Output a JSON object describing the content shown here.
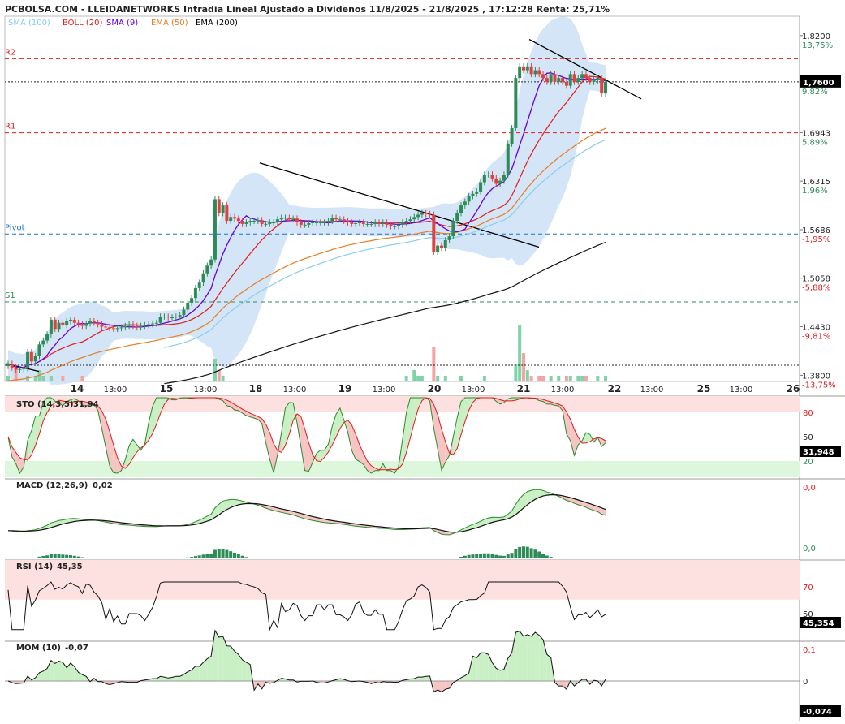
{
  "header": {
    "title": "PCBOLSA.COM - LLEIDANETWORKS Intradia Lineal Ajustado a Dividenos 11/8/2025 - 21/8/2025 , 17:12:28 Renta: 25,71%",
    "legend": [
      {
        "label": "SMA (100)",
        "color": "#87ceeb"
      },
      {
        "label": "BOLL (20)",
        "color": "#e31a1c"
      },
      {
        "label": "SMA (9)",
        "color": "#6a00d8"
      },
      {
        "label": "EMA (50)",
        "color": "#e67e22"
      },
      {
        "label": "EMA (200)",
        "color": "#000000"
      }
    ]
  },
  "price_axis": {
    "ticks": [
      {
        "price": "1,8200",
        "pct": "13,75%",
        "pct_color": "#2e8b57"
      },
      {
        "price": "1,6943",
        "pct": "5,89%",
        "pct_color": "#2e8b57"
      },
      {
        "price": "1,6315",
        "pct": "1,96%",
        "pct_color": "#2e8b57"
      },
      {
        "price": "1,5686",
        "pct": "-1,95%",
        "pct_color": "#e31a1c"
      },
      {
        "price": "1,5058",
        "pct": "-5,88%",
        "pct_color": "#e31a1c"
      },
      {
        "price": "1,4430",
        "pct": "-9,81%",
        "pct_color": "#e31a1c"
      },
      {
        "price": "1,3800",
        "pct": "-13,75%",
        "pct_color": "#e31a1c"
      }
    ],
    "current_price": "1,7600",
    "current_pct": "9,82%"
  },
  "levels": [
    {
      "label": "R2",
      "value": 1.79,
      "color": "#e31a1c"
    },
    {
      "label": "R1",
      "value": 1.694,
      "color": "#e31a1c"
    },
    {
      "label": "Pivot",
      "value": 1.563,
      "color": "#1f6fd1"
    },
    {
      "label": "S1",
      "value": 1.475,
      "color": "#2e8b57"
    }
  ],
  "time_axis": [
    "14",
    "13:00",
    "15",
    "13:00",
    "18",
    "13:00",
    "19",
    "13:00",
    "20",
    "13:00",
    "21",
    "13:00",
    "22",
    "13:00",
    "25",
    "13:00",
    "26"
  ],
  "chart_data": [
    {
      "type": "candlestick",
      "title": "",
      "yrange": [
        1.372,
        1.845
      ],
      "note_values": "approximate values read from the chart",
      "close": [
        1.395,
        1.39,
        1.387,
        1.388,
        1.389,
        1.41,
        1.398,
        1.405,
        1.42,
        1.425,
        1.433,
        1.452,
        1.44,
        1.448,
        1.445,
        1.45,
        1.452,
        1.448,
        1.446,
        1.444,
        1.447,
        1.45,
        1.448,
        1.446,
        1.443,
        1.442,
        1.441,
        1.44,
        1.441,
        1.442,
        1.444,
        1.446,
        1.444,
        1.442,
        1.444,
        1.445,
        1.446,
        1.447,
        1.448,
        1.456,
        1.456,
        1.455,
        1.455,
        1.456,
        1.458,
        1.465,
        1.474,
        1.48,
        1.493,
        1.5,
        1.512,
        1.522,
        1.53,
        1.608,
        1.59,
        1.6,
        1.58,
        1.585,
        1.583,
        1.58,
        1.576,
        1.578,
        1.58,
        1.58,
        1.581,
        1.576,
        1.576,
        1.578,
        1.578,
        1.582,
        1.584,
        1.584,
        1.583,
        1.583,
        1.578,
        1.575,
        1.575,
        1.577,
        1.578,
        1.578,
        1.578,
        1.578,
        1.58,
        1.584,
        1.582,
        1.582,
        1.58,
        1.578,
        1.576,
        1.577,
        1.578,
        1.576,
        1.576,
        1.576,
        1.578,
        1.576,
        1.578,
        1.575,
        1.573,
        1.573,
        1.575,
        1.578,
        1.58,
        1.582,
        1.585,
        1.588,
        1.59,
        1.589,
        1.588,
        1.54,
        1.548,
        1.545,
        1.555,
        1.56,
        1.58,
        1.59,
        1.6,
        1.605,
        1.612,
        1.615,
        1.618,
        1.63,
        1.64,
        1.64,
        1.635,
        1.628,
        1.632,
        1.64,
        1.68,
        1.7,
        1.765,
        1.78,
        1.775,
        1.78,
        1.77,
        1.775,
        1.77,
        1.765,
        1.76,
        1.77,
        1.76,
        1.765,
        1.76,
        1.755,
        1.77,
        1.76,
        1.765,
        1.77,
        1.765,
        1.76,
        1.762,
        1.765,
        1.745,
        1.76
      ],
      "volume": [
        1,
        0,
        2,
        0,
        0,
        1,
        0,
        1,
        2,
        1,
        0,
        1,
        0,
        0,
        1,
        0,
        0,
        0,
        0,
        1,
        0,
        0,
        0,
        0,
        0,
        0,
        0,
        0,
        0,
        0,
        0,
        0,
        0,
        0,
        0,
        0,
        0,
        0,
        0,
        0,
        0,
        0,
        0,
        0,
        0,
        0,
        0,
        0,
        0,
        0,
        0,
        0,
        0,
        4,
        2,
        1,
        0,
        0,
        0,
        0,
        0,
        0,
        0,
        0,
        0,
        0,
        0,
        0,
        0,
        0,
        0,
        0,
        0,
        0,
        0,
        0,
        0,
        0,
        0,
        0,
        0,
        0,
        0,
        0,
        0,
        0,
        0,
        0,
        0,
        0,
        0,
        0,
        0,
        0,
        0,
        0,
        0,
        0,
        0,
        0,
        0,
        0,
        1,
        0,
        2,
        1,
        1,
        0,
        0,
        6,
        1,
        0,
        1,
        0,
        0,
        0,
        1,
        0,
        0,
        0,
        0,
        0,
        1,
        0,
        0,
        0,
        0,
        0,
        0,
        0,
        3,
        10,
        5,
        2,
        1,
        0,
        1,
        1,
        0,
        1,
        0,
        1,
        0,
        1,
        1,
        0,
        1,
        1,
        1,
        0,
        0,
        1,
        0,
        1
      ]
    },
    {
      "type": "line",
      "title": "STO (14,3,5)",
      "value_label": "31,94",
      "ticks": [
        "80",
        "50",
        "20"
      ],
      "last_value": "31,948",
      "ylim": [
        0,
        100
      ]
    },
    {
      "type": "line",
      "title": "MACD (12,26,9)",
      "value_label": "0,02",
      "ticks": [
        "0,0",
        "0,0"
      ],
      "ylim": [
        -1,
        1
      ]
    },
    {
      "type": "line",
      "title": "RSI (14)",
      "value_label": "45,35",
      "ticks": [
        "70",
        "50"
      ],
      "last_value": "45,354",
      "ylim": [
        0,
        100
      ]
    },
    {
      "type": "line",
      "title": "MOM (10)",
      "value_label": "-0,07",
      "ticks": [
        "0,1",
        "0"
      ],
      "last_value": "-0,074",
      "ylim": [
        -0.12,
        0.12
      ]
    }
  ]
}
